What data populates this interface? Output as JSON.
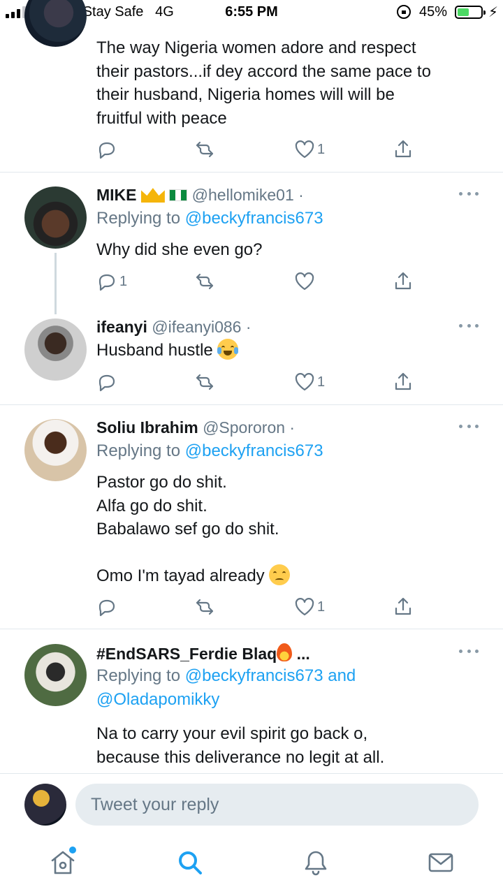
{
  "status_bar": {
    "carrier": "9mobile-Stay Safe",
    "network": "4G",
    "time": "6:55 PM",
    "battery_pct": "45%",
    "battery_level": 0.45,
    "battery_color": "#4cd964"
  },
  "tweets": [
    {
      "text": "The way Nigeria women adore and respect\ntheir pastors...if dey accord the same pace to\ntheir husband, Nigeria homes will will be\nfruitful with peace",
      "likes": "1"
    },
    {
      "name": "MIKE",
      "handle": "@hellomike01 ·",
      "replying_label": "Replying to",
      "replying_mention": "@beckyfrancis673",
      "text": "Why did she even go?",
      "replies": "1",
      "emoji": [
        "crown-icon",
        "nigeria-flag-icon"
      ]
    },
    {
      "name": "ifeanyi",
      "handle": "@ifeanyi086 ·",
      "text": "Husband hustle",
      "likes": "1",
      "emoji": [
        "tears-of-joy-icon"
      ]
    },
    {
      "name": "Soliu Ibrahim",
      "handle": "@Spororon ·",
      "replying_label": "Replying to",
      "replying_mention": "@beckyfrancis673",
      "text": "Pastor go do shit.\nAlfa go do shit.\nBabalawo sef go do shit.\n\nOmo I'm tayad already",
      "likes": "1",
      "emoji": [
        "pensive-face-icon"
      ]
    },
    {
      "name": "#EndSARS_Ferdie Blaq",
      "name_suffix": "...",
      "replying_label": "Replying to",
      "replying_mention": "@beckyfrancis673",
      "replying_and": "and",
      "replying_mention2": "@Oladapomikky",
      "text": "Na to carry your evil spirit go back o,\nbecause this deliverance no legit at all.",
      "emoji": [
        "fire-icon"
      ]
    }
  ],
  "reply_bar": {
    "placeholder": "Tweet your reply"
  },
  "tab_bar": {
    "items": [
      "home-icon",
      "search-icon",
      "notifications-icon",
      "messages-icon"
    ],
    "active": "search-icon",
    "accent": "#1da1f2"
  }
}
